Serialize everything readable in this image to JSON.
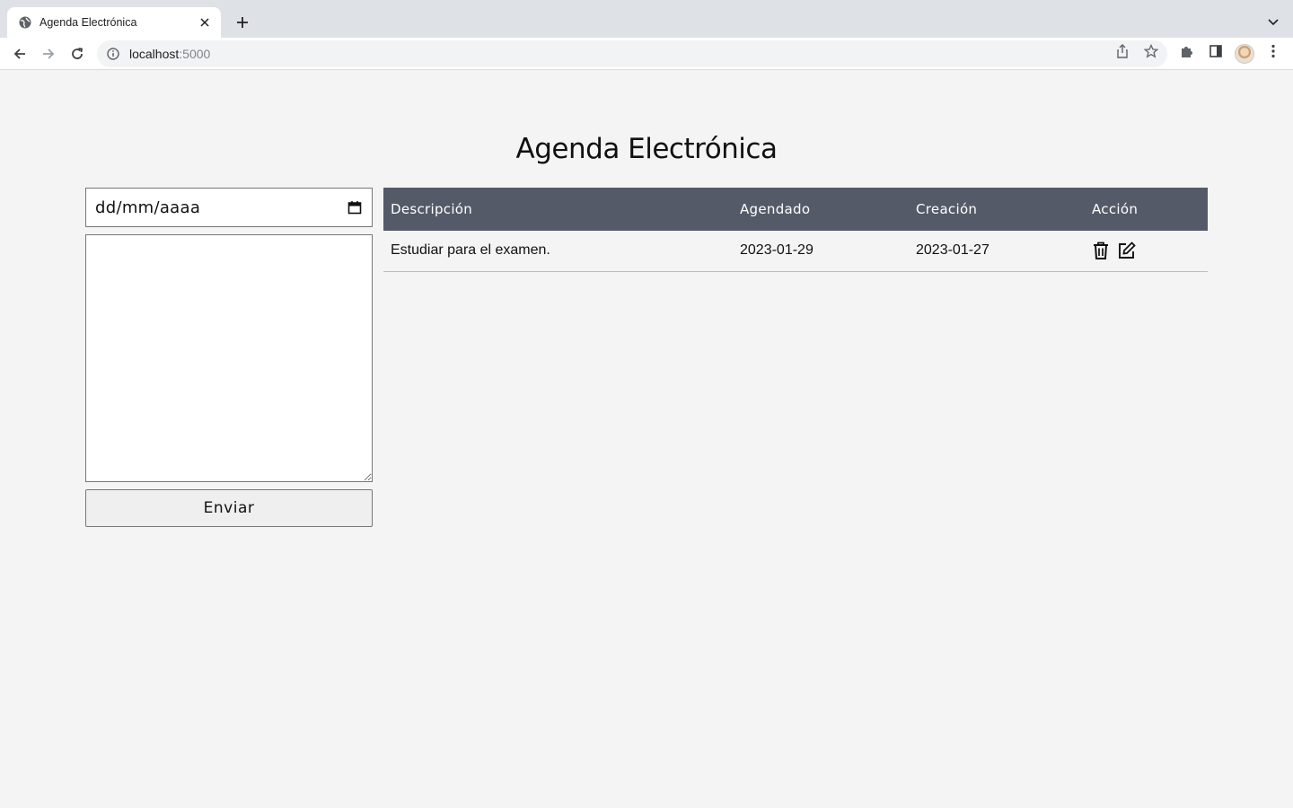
{
  "browser": {
    "tab_title": "Agenda Electrónica",
    "url_host": "localhost",
    "url_port": ":5000"
  },
  "page": {
    "title": "Agenda Electrónica"
  },
  "form": {
    "date_placeholder": "dd/mm/aaaa",
    "description_value": "",
    "submit_label": "Enviar"
  },
  "table": {
    "headers": [
      "Descripción",
      "Agendado",
      "Creación",
      "Acción"
    ],
    "rows": [
      {
        "description": "Estudiar para el examen.",
        "scheduled": "2023-01-29",
        "created": "2023-01-27",
        "actions": [
          "trash-icon",
          "edit-icon"
        ]
      }
    ]
  },
  "colors": {
    "header_bg": "#555a68",
    "page_bg": "#f4f4f4"
  }
}
